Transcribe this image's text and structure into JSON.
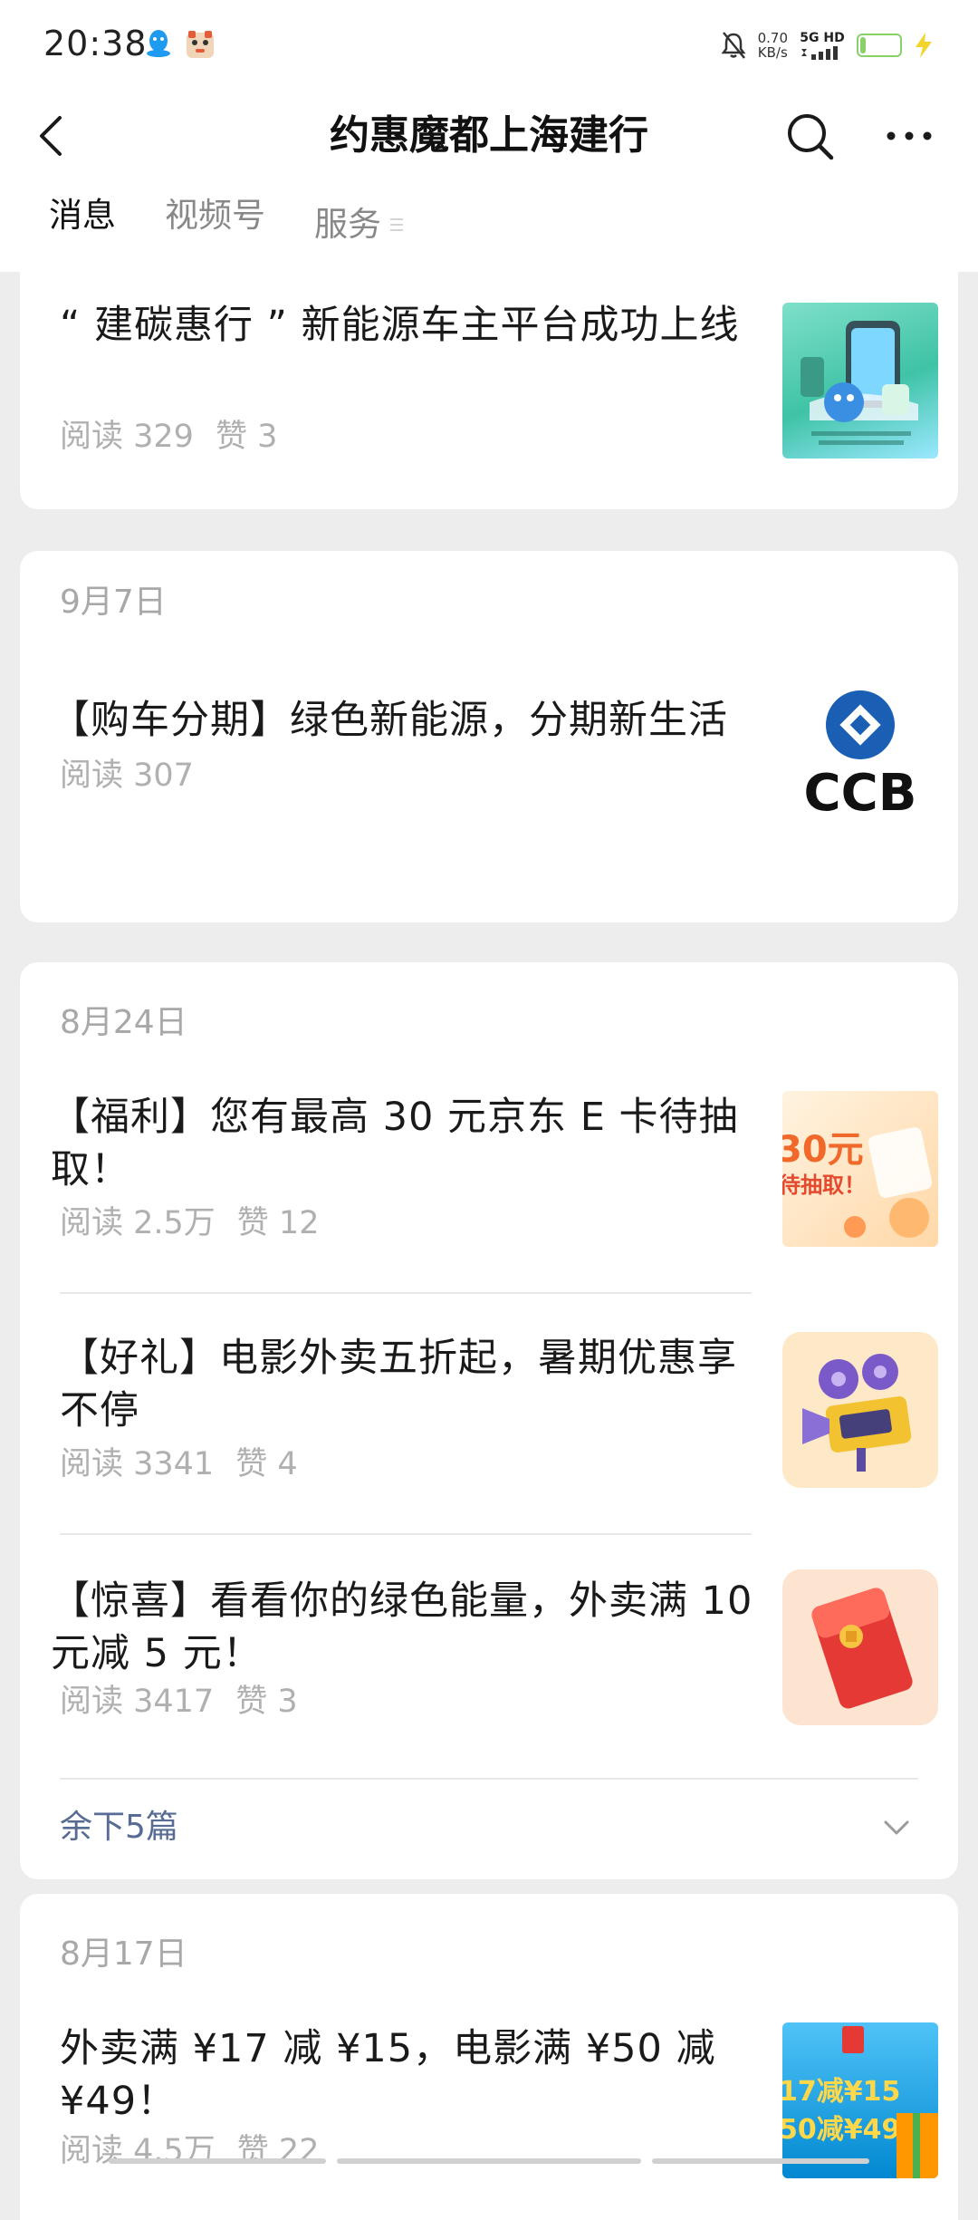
{
  "status_bar": {
    "time": "20:38",
    "net_speed_value": "0.70",
    "net_speed_unit": "KB/s",
    "signal_label": "5G HD",
    "battery": "14",
    "battery_level": 0.14,
    "icons": [
      "qq-icon",
      "app-icon",
      "mute-bell-icon",
      "signal-icon",
      "battery-icon",
      "charging-bolt-icon"
    ]
  },
  "header": {
    "title": "约惠魔都上海建行",
    "tabs": [
      {
        "label": "消息",
        "active": true
      },
      {
        "label": "视频号",
        "active": false
      },
      {
        "label": "服务",
        "active": false
      }
    ]
  },
  "cards": [
    {
      "date": "",
      "articles": [
        {
          "title": "“ 建碳惠行 ” 新能源车主平台成功上线",
          "reads": "阅读 329",
          "likes": "赞 3",
          "thumb": "green-car-thumb"
        }
      ]
    },
    {
      "date": "9月7日",
      "articles": [
        {
          "title": "【购车分期】绿色新能源，分期新生活",
          "reads": "阅读 307",
          "likes": "",
          "thumb": "ccb-logo-thumb",
          "thumb_text": "CCB"
        }
      ]
    },
    {
      "date": "8月24日",
      "articles": [
        {
          "title": "【福利】您有最高 30 元京东 E 卡待抽取！",
          "reads": "阅读 2.5万",
          "likes": "赞 12",
          "thumb": "jd-card-thumb",
          "thumb_text_1": "30元",
          "thumb_text_2": "待抽取！"
        },
        {
          "title": "【好礼】电影外卖五折起，暑期优惠享不停",
          "reads": "阅读 3341",
          "likes": "赞 4",
          "thumb": "projector-thumb"
        },
        {
          "title": "【惊喜】看看你的绿色能量，外卖满 10 元减 5 元！",
          "reads": "阅读 3417",
          "likes": "赞 3",
          "thumb": "red-envelope-thumb"
        }
      ],
      "more_label": "余下5篇"
    },
    {
      "date": "8月17日",
      "articles": [
        {
          "title": "外卖满 ¥17 减 ¥15，电影满 ¥50 减 ¥49！",
          "reads": "阅读 4.5万",
          "likes": "赞 22",
          "thumb": "coupon-thumb",
          "thumb_text_1": "17减¥15",
          "thumb_text_2": "50减¥49"
        }
      ]
    }
  ],
  "colors": {
    "background": "#ededed",
    "link": "#576b95",
    "meta": "#b0b0b0"
  }
}
